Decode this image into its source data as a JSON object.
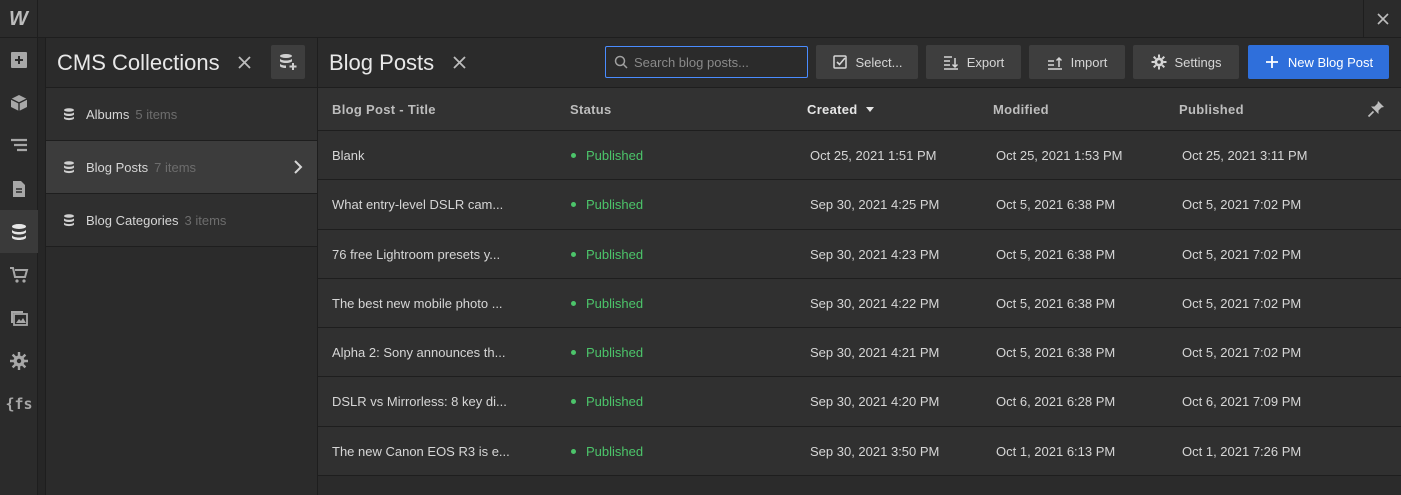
{
  "app": {
    "logo_text": "W",
    "close_label": "✕"
  },
  "rail": {
    "items": [
      {
        "icon": "add-icon"
      },
      {
        "icon": "cube-icon"
      },
      {
        "icon": "navigator-icon"
      },
      {
        "icon": "pages-icon"
      },
      {
        "icon": "cms-database-icon",
        "active": true
      },
      {
        "icon": "ecommerce-cart-icon"
      },
      {
        "icon": "assets-icon"
      },
      {
        "icon": "settings-gear-icon"
      },
      {
        "icon": "finsweet-icon",
        "text": "{fs"
      }
    ]
  },
  "collections": {
    "title": "CMS Collections",
    "items": [
      {
        "name": "Albums",
        "count": "5 items"
      },
      {
        "name": "Blog Posts",
        "count": "7 items",
        "active": true
      },
      {
        "name": "Blog Categories",
        "count": "3 items"
      }
    ]
  },
  "main": {
    "title": "Blog Posts",
    "search_placeholder": "Search blog posts...",
    "buttons": {
      "select": "Select...",
      "export": "Export",
      "import": "Import",
      "settings": "Settings",
      "new": "New Blog Post"
    },
    "columns": [
      "Blog Post - Title",
      "Status",
      "Created",
      "Modified",
      "Published"
    ],
    "sorted_column": "Created",
    "rows": [
      {
        "title": "Blank",
        "status": "Published",
        "created": "Oct 25, 2021 1:51 PM",
        "modified": "Oct 25, 2021 1:53 PM",
        "published": "Oct 25, 2021 3:11 PM"
      },
      {
        "title": "What entry-level DSLR cam...",
        "status": "Published",
        "created": "Sep 30, 2021 4:25 PM",
        "modified": "Oct 5, 2021 6:38 PM",
        "published": "Oct 5, 2021 7:02 PM"
      },
      {
        "title": "76 free Lightroom presets y...",
        "status": "Published",
        "created": "Sep 30, 2021 4:23 PM",
        "modified": "Oct 5, 2021 6:38 PM",
        "published": "Oct 5, 2021 7:02 PM"
      },
      {
        "title": "The best new mobile photo ...",
        "status": "Published",
        "created": "Sep 30, 2021 4:22 PM",
        "modified": "Oct 5, 2021 6:38 PM",
        "published": "Oct 5, 2021 7:02 PM"
      },
      {
        "title": "Alpha 2: Sony announces th...",
        "status": "Published",
        "created": "Sep 30, 2021 4:21 PM",
        "modified": "Oct 5, 2021 6:38 PM",
        "published": "Oct 5, 2021 7:02 PM"
      },
      {
        "title": "DSLR vs Mirrorless: 8 key di...",
        "status": "Published",
        "created": "Sep 30, 2021 4:20 PM",
        "modified": "Oct 6, 2021 6:28 PM",
        "published": "Oct 6, 2021 7:09 PM"
      },
      {
        "title": "The new Canon EOS R3 is e...",
        "status": "Published",
        "created": "Sep 30, 2021 3:50 PM",
        "modified": "Oct 1, 2021 6:13 PM",
        "published": "Oct 1, 2021 7:26 PM"
      }
    ]
  },
  "colors": {
    "accent": "#2f6fdb",
    "status_published": "#4cc46a",
    "search_focus": "#4a8cff"
  }
}
